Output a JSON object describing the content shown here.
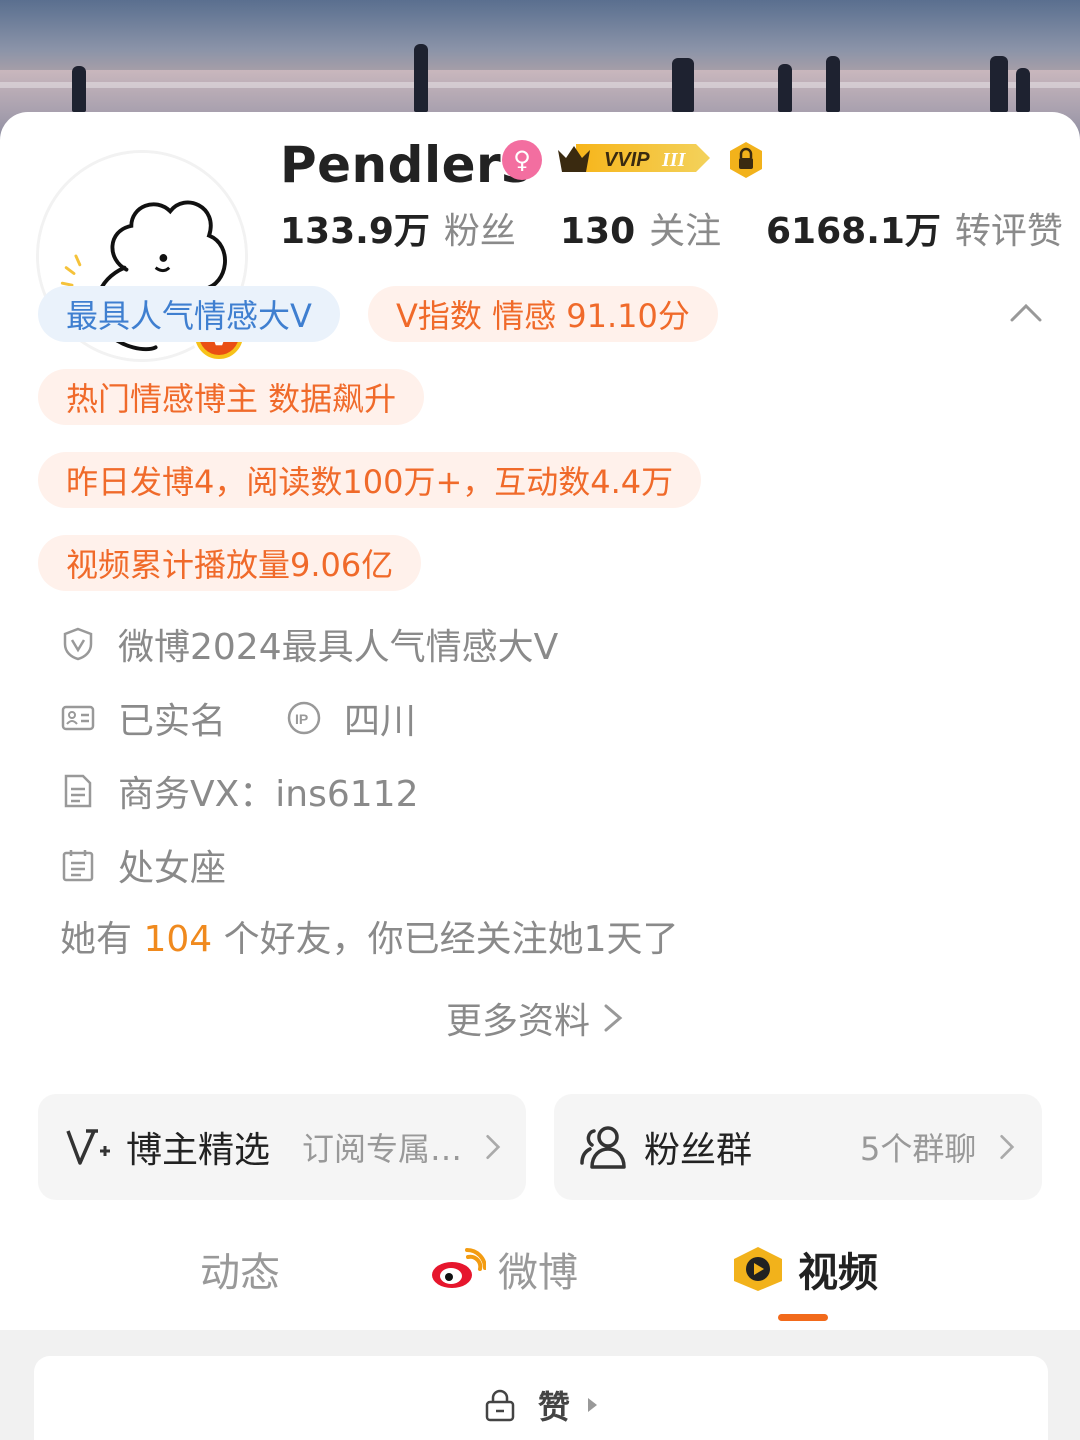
{
  "profile": {
    "name": "Pendlers",
    "stats": [
      {
        "num": "133.9万",
        "label": "粉丝"
      },
      {
        "num": "130",
        "label": "关注"
      },
      {
        "num": "6168.1万",
        "label": "转评赞"
      }
    ],
    "vvip_label": "VVIP"
  },
  "tags": {
    "popular": "最具人气情感大V",
    "v_index": "V指数 情感 91.10分",
    "hot": "热门情感博主 数据飙升",
    "yesterday": "昨日发博4，阅读数100万+，互动数4.4万",
    "video_total": "视频累计播放量9.06亿"
  },
  "info": {
    "award": "微博2024最具人气情感大V",
    "verified": "已实名",
    "ip_region": "四川",
    "business": "商务VX：ins6112",
    "zodiac": "处女座",
    "friends_pre": "她有 ",
    "friends_count": "104",
    "friends_post": " 个好友，你已经关注她1天了",
    "more": "更多资料"
  },
  "entries": {
    "picks_title": "博主精选",
    "picks_sub": "订阅专属…",
    "fans_title": "粉丝群",
    "fans_sub": "5个群聊"
  },
  "tabs": {
    "dynamic": "动态",
    "weibo": "微博",
    "video": "视频"
  },
  "bottom": {
    "like": "赞"
  },
  "colors": {
    "accent": "#f26a1b",
    "tag_blue": "#3f7fd0",
    "tag_orange": "#f06a2a",
    "highlight": "#f08a1e"
  }
}
